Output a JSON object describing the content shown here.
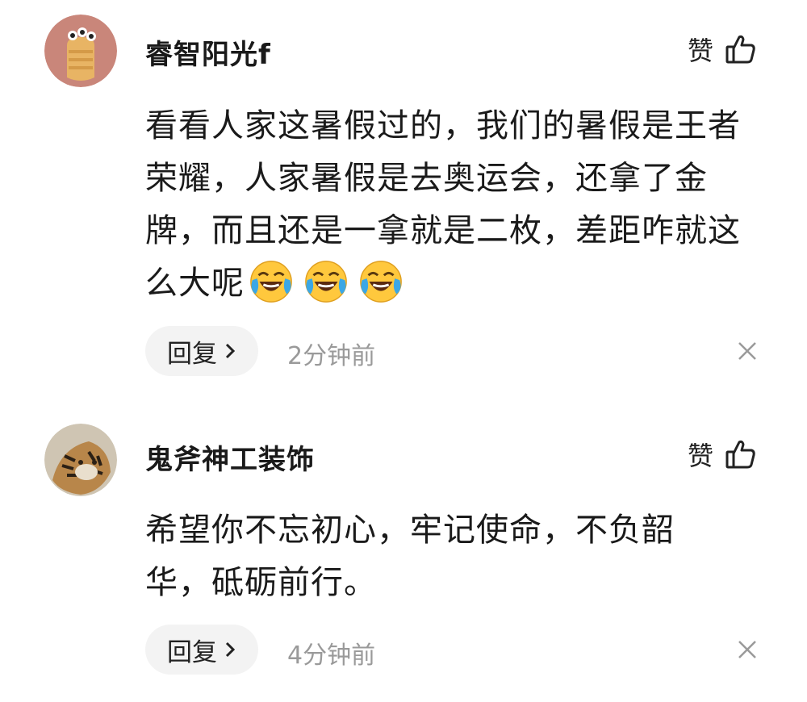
{
  "comments": [
    {
      "username": "睿智阳光f",
      "like_label": "赞",
      "text": "看看人家这暑假过的，我们的暑假是王者荣耀，人家暑假是去奥运会，还拿了金牌，而且还是一拿就是二枚，差距咋就这么大呢",
      "emojis": [
        "crying-laughing-emoji",
        "crying-laughing-emoji",
        "crying-laughing-emoji"
      ],
      "reply_label": "回复",
      "time": "2分钟前"
    },
    {
      "username": "鬼斧神工装饰",
      "like_label": "赞",
      "text": "希望你不忘初心，牢记使命，不负韶华，砥砺前行。",
      "reply_label": "回复",
      "time": "4分钟前"
    }
  ],
  "colors": {
    "reply_bg": "#f3f3f3",
    "time_text": "#9a9a9a",
    "emoji_yellow": "#FFC83D",
    "tears_blue": "#3BA7E5"
  }
}
